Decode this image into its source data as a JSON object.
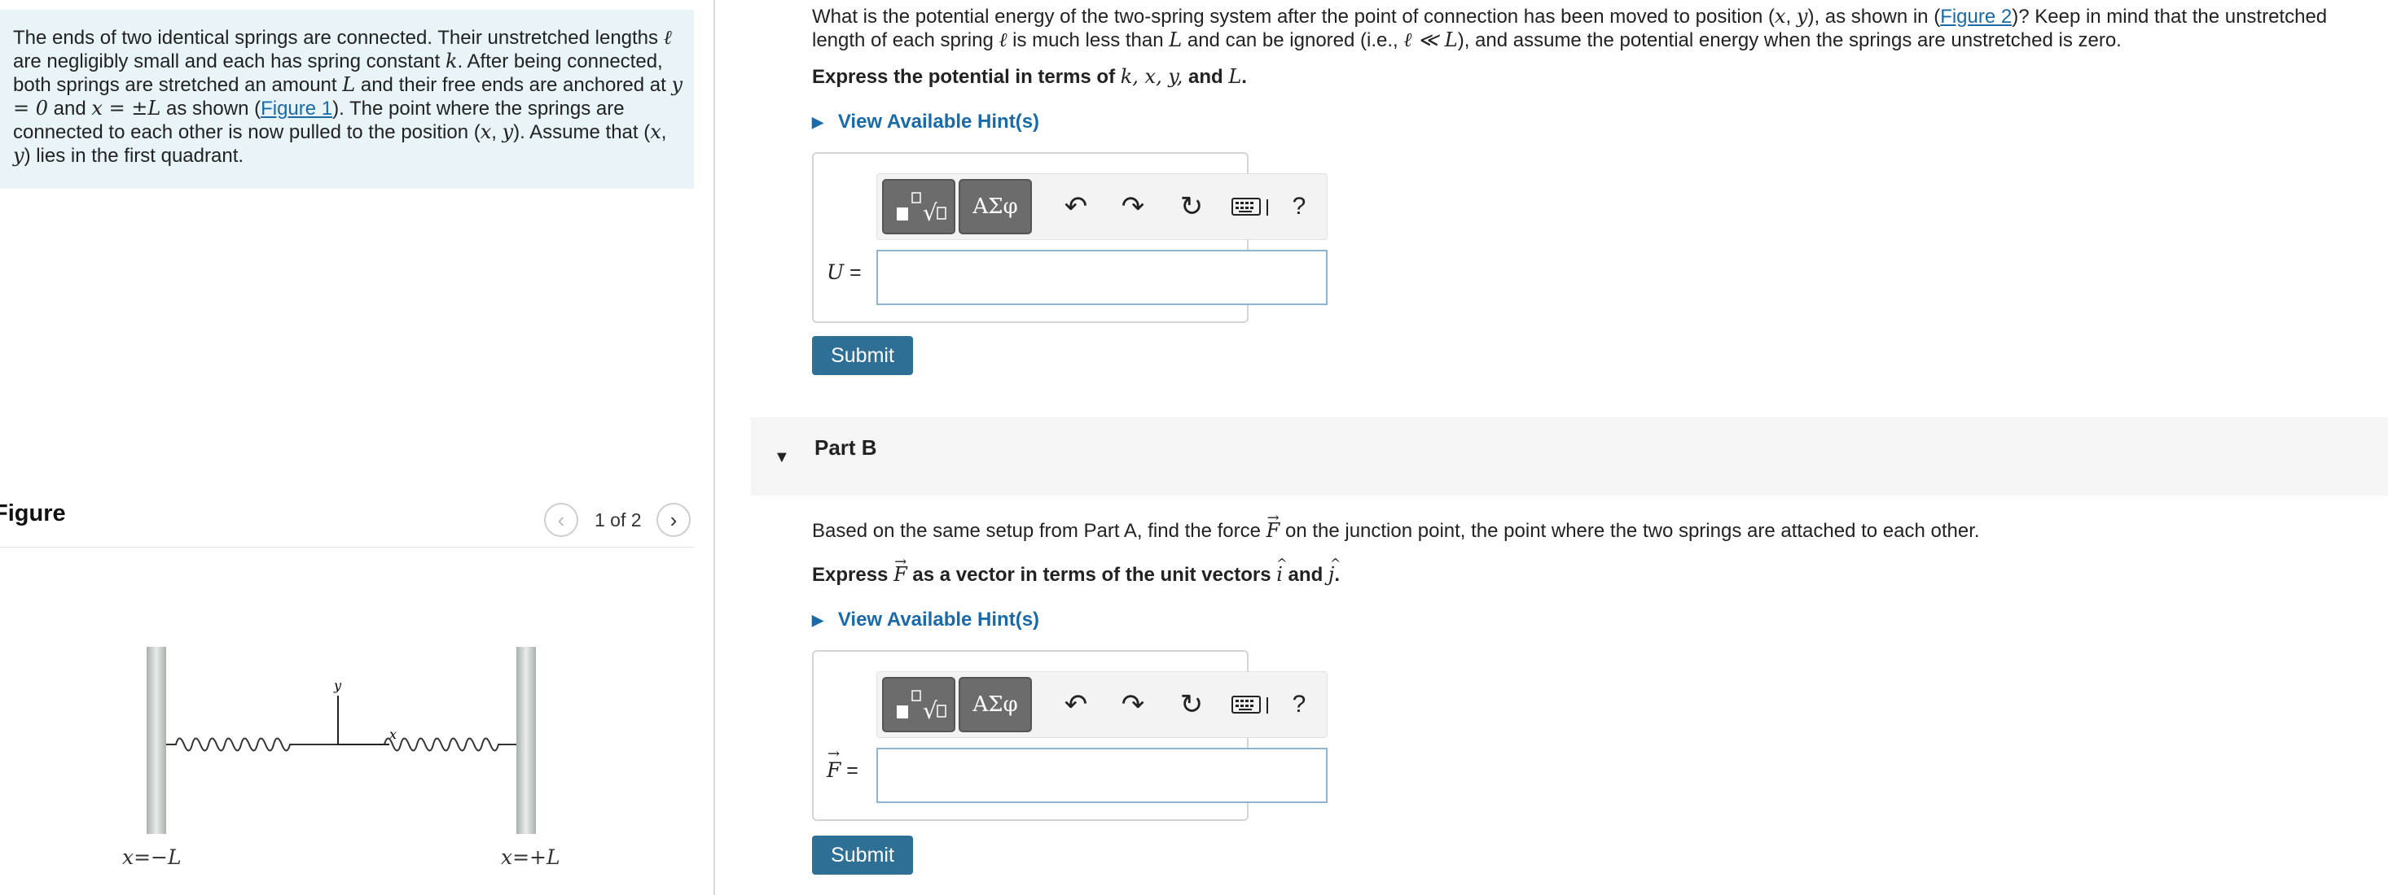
{
  "intro": {
    "t1": "The ends of two identical springs are connected. Their unstretched lengths ",
    "ell": "ℓ",
    "t2": " are negligibly small and each has spring constant ",
    "k": "k",
    "t3": ". After being connected, both springs are stretched an amount ",
    "L": "L",
    "t4": " and their free ends are anchored at ",
    "y0": "y = 0",
    "t5": " and ",
    "xpm": "x = ±L",
    "t6": " as shown (",
    "fig1": "Figure 1",
    "t7": "). The point where the springs are connected to each other is now pulled to the position (",
    "x": "x",
    "comma": ", ",
    "y": "y",
    "t8": "). Assume that (",
    "t9": ") lies in the first quadrant."
  },
  "figure_panel": {
    "title": "Figure",
    "pager": "1 of 2",
    "label_left": "x=−L",
    "label_right": "x=+L",
    "axis_y": "y",
    "axis_x": "x"
  },
  "partA": {
    "q1": "What is the potential energy of the two-spring system after the point of connection has been moved to position (",
    "q2": "), as shown in (",
    "fig2": "Figure 2",
    "q3": ")? Keep in mind that the unstretched length of each spring ",
    "q4": " is much less than ",
    "q5": " and can be ignored (i.e., ",
    "ll": "ℓ ≪ L",
    "q6": "), and assume the potential energy when the springs are unstretched is zero.",
    "instr1": "Express the potential in terms of ",
    "instr_vars": "k, x, y,",
    "instr2": " and ",
    "instr3": ".",
    "hint": "View Available Hint(s)",
    "input_label": "U",
    "eq": " =",
    "input_value": "",
    "submit": "Submit"
  },
  "partB": {
    "title": "Part B",
    "q1": "Based on the same setup from Part A, find the force ",
    "F": "F",
    "q2": " on the junction point, the point where the two springs are attached to each other.",
    "instr1": "Express ",
    "instr2": " as a vector in terms of the unit vectors ",
    "i": "i",
    "and": " and ",
    "j": "j",
    "dot": ".",
    "hint": "View Available Hint(s)",
    "input_label": "F",
    "eq": " =",
    "input_value": "",
    "submit": "Submit"
  },
  "toolbar": {
    "templates": "√",
    "greek": "ΑΣφ",
    "undo": "↶",
    "redo": "↷",
    "reset": "↻",
    "help": "?"
  }
}
